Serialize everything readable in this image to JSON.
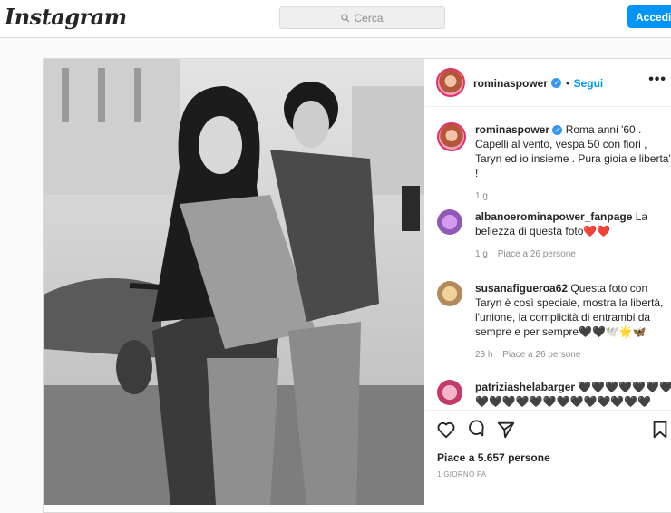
{
  "topbar": {
    "logo": "Instagram",
    "search_placeholder": "Cerca",
    "login_label": "Accedi"
  },
  "post": {
    "author": "rominaspower",
    "follow_label": "Segui",
    "more_label": "•••",
    "caption": {
      "username": "rominaspower",
      "text": "Roma anni '60 . Capelli al vento, vespa 50 con fiori , Taryn ed io insieme . Pura gioia e liberta' !",
      "time": "1 g"
    },
    "comments": [
      {
        "username": "albanoerominapower_fanpage",
        "text": "La bellezza di questa foto❤️❤️",
        "time": "1 g",
        "likes": "Piace a 26 persone"
      },
      {
        "username": "susanafigueroa62",
        "text": "Questa foto con Taryn è così speciale, mostra la libertà, l'unione, la complicità di entrambi da sempre e per sempre🖤🖤🕊️🌟🦋",
        "time": "23 h",
        "likes": "Piace a 26 persone"
      },
      {
        "username": "patriziashelabarger",
        "text": "🖤🖤🖤🖤🖤🖤🖤🖤🖤🖤🖤🖤🖤🖤🖤🖤🖤🖤🖤🖤",
        "time": "",
        "likes": ""
      }
    ],
    "likes_label": "Piace a 5.657 persone",
    "date_label": "1 GIORNO FA"
  },
  "icons": {
    "search": "search-icon",
    "verified": "verified-badge-icon",
    "like": "heart-icon",
    "comment": "comment-icon",
    "share": "paper-plane-icon",
    "save": "bookmark-icon"
  },
  "colors": {
    "accent": "#0095f6",
    "border": "#dbdbdb",
    "muted": "#8e8e8e",
    "text": "#262626"
  }
}
